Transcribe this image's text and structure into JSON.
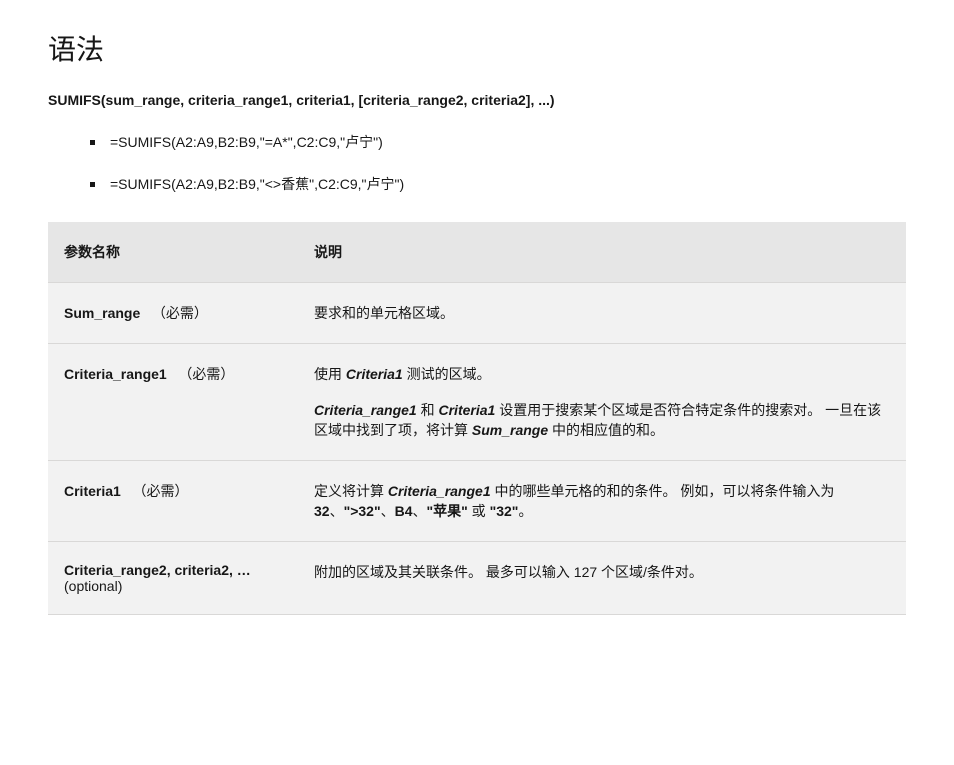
{
  "title": "语法",
  "syntax_line": "SUMIFS(sum_range, criteria_range1, criteria1, [criteria_range2, criteria2], ...)",
  "examples": [
    "=SUMIFS(A2:A9,B2:B9,\"=A*\",C2:C9,\"卢宁\")",
    "=SUMIFS(A2:A9,B2:B9,\"<>香蕉\",C2:C9,\"卢宁\")"
  ],
  "table": {
    "headers": {
      "name": "参数名称",
      "desc": "说明"
    },
    "rows": [
      {
        "name": "Sum_range",
        "note": "（必需）",
        "desc_parts": [
          [
            {
              "t": "要求和的单元格区域。"
            }
          ]
        ]
      },
      {
        "name": "Criteria_range1",
        "note": "（必需）",
        "desc_parts": [
          [
            {
              "t": "使用 "
            },
            {
              "t": "Criteria1",
              "cls": "bi"
            },
            {
              "t": " 测试的区域。"
            }
          ],
          [
            {
              "t": "Criteria_range1",
              "cls": "bi"
            },
            {
              "t": " 和 "
            },
            {
              "t": "Criteria1",
              "cls": "bi"
            },
            {
              "t": " 设置用于搜索某个区域是否符合特定条件的搜索对。 一旦在该区域中找到了项，将计算 "
            },
            {
              "t": "Sum_range",
              "cls": "bi"
            },
            {
              "t": " 中的相应值的和。"
            }
          ]
        ]
      },
      {
        "name": "Criteria1",
        "note": "（必需）",
        "desc_parts": [
          [
            {
              "t": "定义将计算 "
            },
            {
              "t": "Criteria_range1",
              "cls": "bi"
            },
            {
              "t": " 中的哪些单元格的和的条件。 例如，可以将条件输入为 "
            },
            {
              "t": "32",
              "cls": "b"
            },
            {
              "t": "、"
            },
            {
              "t": "\">32\"",
              "cls": "b"
            },
            {
              "t": "、"
            },
            {
              "t": "B4",
              "cls": "b"
            },
            {
              "t": "、"
            },
            {
              "t": "\"苹果\"",
              "cls": "b"
            },
            {
              "t": " 或 "
            },
            {
              "t": "\"32\"",
              "cls": "b"
            },
            {
              "t": "。"
            }
          ]
        ]
      },
      {
        "name": "Criteria_range2, criteria2, …",
        "note": "(optional)",
        "desc_parts": [
          [
            {
              "t": "附加的区域及其关联条件。 最多可以输入 127 个区域/条件对。"
            }
          ]
        ]
      }
    ]
  }
}
